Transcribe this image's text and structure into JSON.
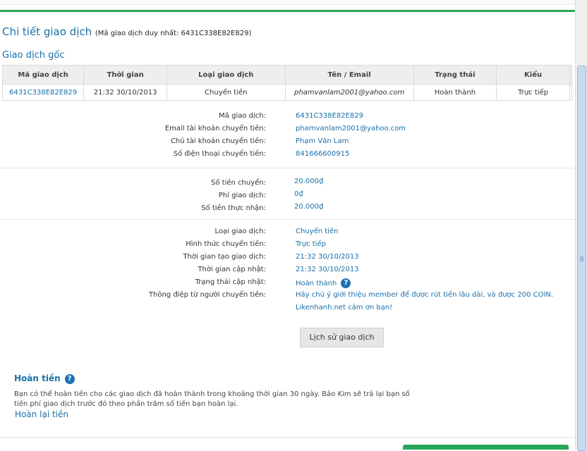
{
  "header": {
    "title": "Chi tiết giao dịch",
    "unique_id_text": "(Mã giao dịch duy nhất: 6431C338E82E829)"
  },
  "original": {
    "section_title": "Giao dịch gốc",
    "columns": [
      "Mã giao dịch",
      "Thời gian",
      "Loại giao dịch",
      "Tên / Email",
      "Trạng thái",
      "Kiểu"
    ],
    "row": {
      "code": "6431C338E82E829",
      "time": "21:32 30/10/2013",
      "type": "Chuyển tiền",
      "email": "phamvanlam2001@yahoo.com",
      "status": "Hoàn thành",
      "kind": "Trực tiếp"
    }
  },
  "sender": {
    "code_label": "Mã giao dịch:",
    "code_value": "6431C338E82E829",
    "email_label": "Email tài khoản chuyển tiền:",
    "email_value": "phamvanlam2001@yahoo.com",
    "owner_label": "Chủ tài khoản chuyển tiền:",
    "owner_value": "Phạm Văn Lam",
    "phone_label": "Số điện thoại chuyển tiền:",
    "phone_value": "841666600915"
  },
  "amounts": {
    "sent_label": "Số tiền chuyển:",
    "sent_value": "20.000₫",
    "fee_label": "Phí giao dịch:",
    "fee_value": "0₫",
    "received_label": "Số tiền thực nhận:",
    "received_value": "20.000₫"
  },
  "details": {
    "type_label": "Loại giao dịch:",
    "type_value": "Chuyển tiền",
    "form_label": "Hình thức chuyển tiền:",
    "form_value": "Trực tiếp",
    "created_label": "Thời gian tạo giao dịch:",
    "created_value": "21:32 30/10/2013",
    "updated_label": "Thời gian cập nhật:",
    "updated_value": "21:32 30/10/2013",
    "status_label": "Trạng thái cập nhật:",
    "status_value": "Hoàn thành",
    "message_label": "Thông điệp từ người chuyển tiền:",
    "message_line1": "Hãy chú ý giới thiệu member để được rút tiền lâu dài, và được 200 COIN.",
    "message_line2": "Likenhanh.net cảm ơn bạn!",
    "help_glyph": "?"
  },
  "history_button": "Lịch sử giao dịch",
  "refund": {
    "title": "Hoàn tiền",
    "text": "Bạn có thể hoàn tiền cho các giao dịch đã hoàn thành trong khoảng thời gian 30 ngày. Bảo Kim sẽ trả lại bạn số tiền phí giao dịch trước đó theo phần trăm số tiền bạn hoàn lại.",
    "link": "Hoàn lại tiền",
    "help_glyph": "?"
  }
}
